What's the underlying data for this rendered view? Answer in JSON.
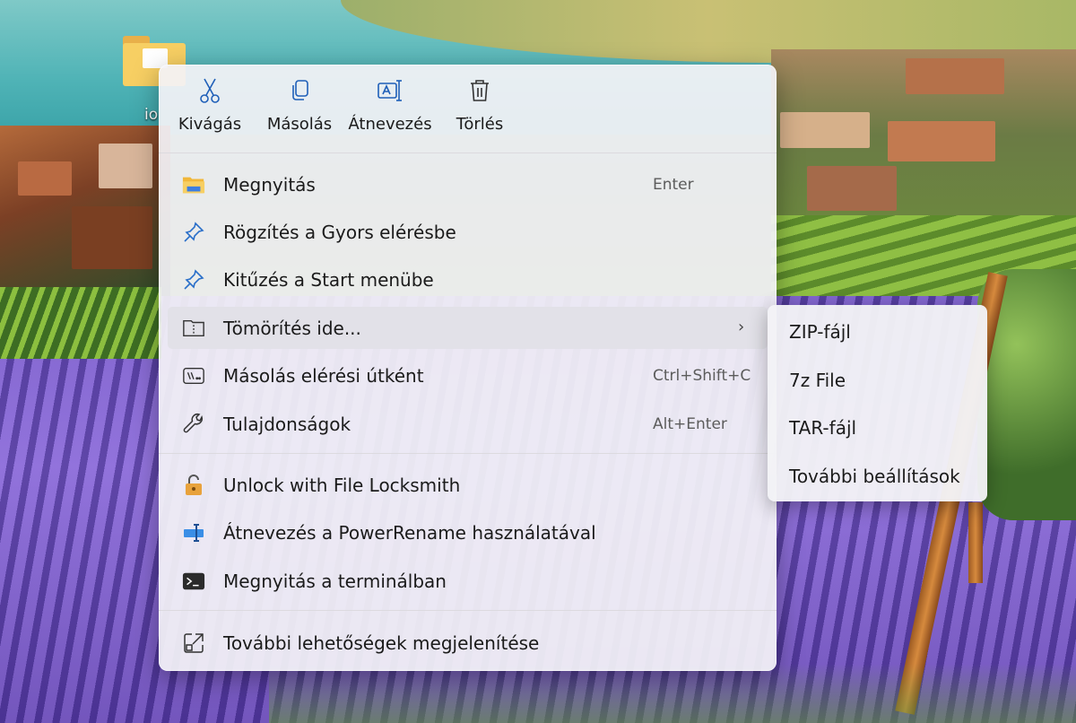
{
  "desktop": {
    "icon_label": "io"
  },
  "toolbar": {
    "buttons": [
      {
        "label": "Kivágás",
        "icon": "scissors-icon"
      },
      {
        "label": "Másolás",
        "icon": "copy-icon"
      },
      {
        "label": "Átnevezés",
        "icon": "rename-icon"
      },
      {
        "label": "Törlés",
        "icon": "trash-icon"
      }
    ]
  },
  "menu": {
    "items": [
      {
        "label": "Megnyitás",
        "shortcut": "Enter",
        "icon": "folder-icon"
      },
      {
        "label": "Rögzítés a Gyors elérésbe",
        "shortcut": "",
        "icon": "pin-icon"
      },
      {
        "label": "Kitűzés a Start menübe",
        "shortcut": "",
        "icon": "pin-icon"
      },
      {
        "label": "Tömörítés ide...",
        "shortcut": "",
        "icon": "zip-folder-icon",
        "has_submenu": true,
        "highlighted": true
      },
      {
        "label": "Másolás elérési útként",
        "shortcut": "Ctrl+Shift+C",
        "icon": "copy-path-icon"
      },
      {
        "label": "Tulajdonságok",
        "shortcut": "Alt+Enter",
        "icon": "wrench-icon"
      },
      {
        "label": "Unlock with File Locksmith",
        "shortcut": "",
        "icon": "lock-icon"
      },
      {
        "label": "Átnevezés a PowerRename használatával",
        "shortcut": "",
        "icon": "power-rename-icon"
      },
      {
        "label": "Megnyitás a terminálban",
        "shortcut": "",
        "icon": "terminal-icon"
      },
      {
        "label": "További lehetőségek megjelenítése",
        "shortcut": "",
        "icon": "more-options-icon"
      }
    ]
  },
  "submenu": {
    "items": [
      {
        "label": "ZIP-fájl"
      },
      {
        "label": "7z File"
      },
      {
        "label": "TAR-fájl"
      },
      {
        "label": "További beállítások"
      }
    ]
  },
  "colors": {
    "menu_bg": "#f3f2f6",
    "highlight": "#e1e0e7",
    "accent_blue": "#2a6fc9",
    "folder_yellow": "#f7cf63"
  }
}
